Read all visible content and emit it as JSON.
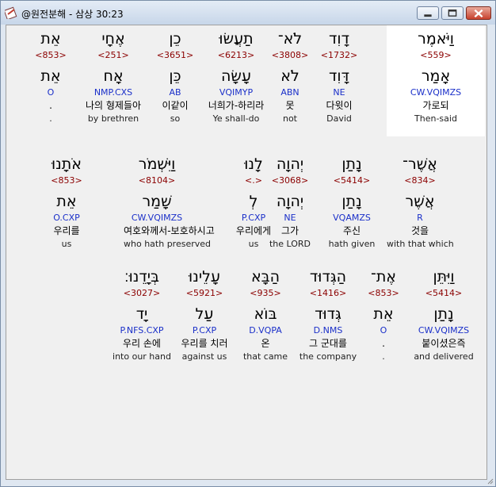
{
  "window": {
    "title": "@원전분해 - 삼상 30:23"
  },
  "rows": [
    {
      "words": [
        {
          "heb": "וַיֹּאמֶר",
          "num": "<559>",
          "lemma": "אָמַר",
          "parse": "CW.VQIMZS",
          "kor": "가로되",
          "eng": "Then-said",
          "highlight": true
        },
        {
          "heb": "דָוִד",
          "num": "<1732>",
          "lemma": "דָּוִד",
          "parse": "NE",
          "kor": "다윗이",
          "eng": "David"
        },
        {
          "heb": "לֹא־",
          "num": "<3808>",
          "lemma": "לֹא",
          "parse": "ABN",
          "kor": "못",
          "eng": "not"
        },
        {
          "heb": "תַעֲשׂוּ",
          "num": "<6213>",
          "lemma": "עָשָׂה",
          "parse": "VQIMYP",
          "kor": "너희가-하리라",
          "eng": "Ye shall-do"
        },
        {
          "heb": "כֵן",
          "num": "<3651>",
          "lemma": "כֵּן",
          "parse": "AB",
          "kor": "이같이",
          "eng": "so"
        },
        {
          "heb": "אֶחָי",
          "num": "<251>",
          "lemma": "אָח",
          "parse": "NMP.CXS",
          "kor": "나의 형제들아",
          "eng": "by brethren"
        },
        {
          "heb": "אֵת",
          "num": "<853>",
          "lemma": "אֵת",
          "parse": "O",
          "kor": ".",
          "eng": "."
        }
      ]
    },
    {
      "words": [
        {
          "heb": "אֲשֶׁר־",
          "num": "<834>",
          "lemma": "אֲשֶׁר",
          "parse": "R",
          "kor": "것을",
          "eng": "with that which"
        },
        {
          "heb": "נָתַן",
          "num": "<5414>",
          "lemma": "נָתַן",
          "parse": "VQAMZS",
          "kor": "주신",
          "eng": "hath given"
        },
        {
          "heb": "יְהוָה",
          "num": "<3068>",
          "lemma": "יְהוָה",
          "parse": "NE",
          "kor": "그가",
          "eng": "the LORD"
        },
        {
          "heb": "לָנוּ",
          "num": "<.>",
          "lemma": "לְ",
          "parse": "P.CXP",
          "kor": "우리에게",
          "eng": "us"
        },
        {
          "heb": "וַיִּשְׁמֹר",
          "num": "<8104>",
          "lemma": "שָׁמַר",
          "parse": "CW.VQIMZS",
          "kor": "여호와께서-보호하시고",
          "eng": "who hath preserved"
        },
        {
          "heb": "אֹתָנוּ",
          "num": "<853>",
          "lemma": "אֵת",
          "parse": "O.CXP",
          "kor": "우리를",
          "eng": "us"
        }
      ]
    },
    {
      "words": [
        {
          "heb": "וַיִּתֵּן",
          "num": "<5414>",
          "lemma": "נָתַן",
          "parse": "CW.VQIMZS",
          "kor": "붙이셨은즉",
          "eng": "and delivered"
        },
        {
          "heb": "אֶת־",
          "num": "<853>",
          "lemma": "אֵת",
          "parse": "O",
          "kor": ".",
          "eng": "."
        },
        {
          "heb": "הַגְּדוּד",
          "num": "<1416>",
          "lemma": "גְּדוּד",
          "parse": "D.NMS",
          "kor": "그 군대를",
          "eng": "the company"
        },
        {
          "heb": "הַבָּא",
          "num": "<935>",
          "lemma": "בּוֹא",
          "parse": "D.VQPA",
          "kor": "온",
          "eng": "that came"
        },
        {
          "heb": "עָלֵינוּ",
          "num": "<5921>",
          "lemma": "עַל",
          "parse": "P.CXP",
          "kor": "우리를 치러",
          "eng": "against us"
        },
        {
          "heb": "בְּיָדֵנוּ׃",
          "num": "<3027>",
          "lemma": "יָד",
          "parse": "P.NFS.CXP",
          "kor": "우리 손에",
          "eng": "into our hand"
        }
      ]
    }
  ],
  "colors": {
    "strong_number": "#8b0000",
    "parse_code": "#1a2fc9",
    "highlight": "#ffffff"
  }
}
